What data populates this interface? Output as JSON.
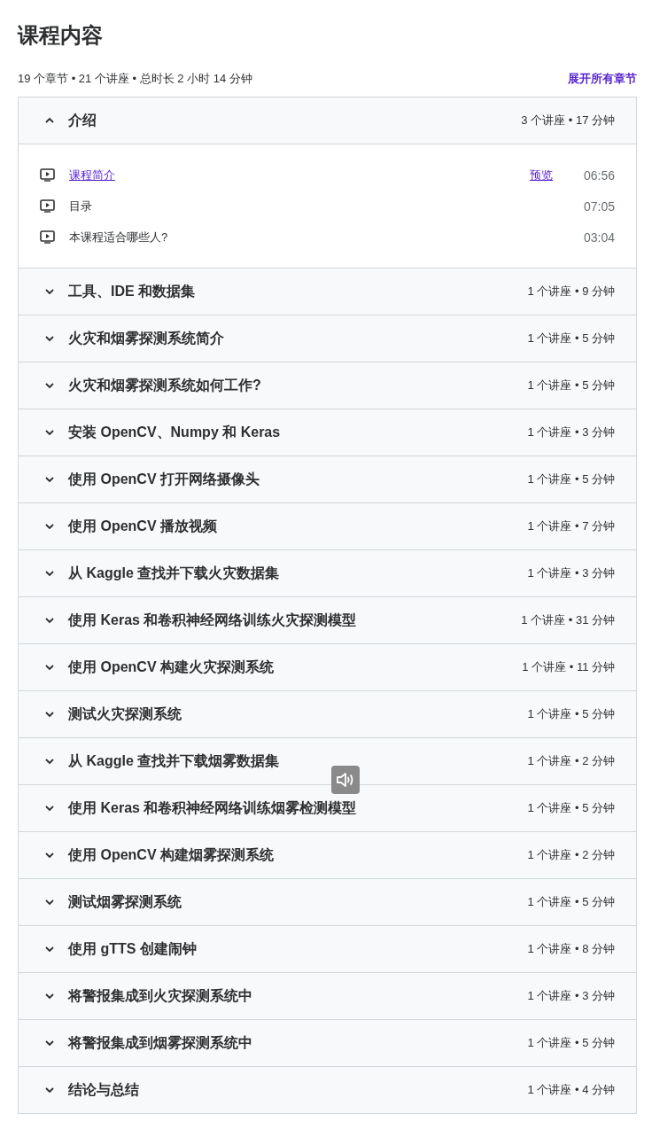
{
  "title": "课程内容",
  "summary": "19 个章节 • 21 个讲座 • 总时长 2 小时 14 分钟",
  "expand_all": "展开所有章节",
  "sections": [
    {
      "title": "介绍",
      "meta": "3 个讲座 • 17 分钟",
      "expanded": true,
      "lectures": [
        {
          "title": "课程简介",
          "link": true,
          "preview": "预览",
          "duration": "06:56"
        },
        {
          "title": "目录",
          "link": false,
          "duration": "07:05"
        },
        {
          "title": "本课程适合哪些人?",
          "link": false,
          "duration": "03:04"
        }
      ]
    },
    {
      "title": "工具、IDE 和数据集",
      "meta": "1 个讲座 • 9 分钟",
      "expanded": false
    },
    {
      "title": "火灾和烟雾探测系统简介",
      "meta": "1 个讲座 • 5 分钟",
      "expanded": false
    },
    {
      "title": "火灾和烟雾探测系统如何工作?",
      "meta": "1 个讲座 • 5 分钟",
      "expanded": false
    },
    {
      "title": "安装 OpenCV、Numpy 和 Keras",
      "meta": "1 个讲座 • 3 分钟",
      "expanded": false
    },
    {
      "title": "使用 OpenCV 打开网络摄像头",
      "meta": "1 个讲座 • 5 分钟",
      "expanded": false
    },
    {
      "title": "使用 OpenCV 播放视频",
      "meta": "1 个讲座 • 7 分钟",
      "expanded": false
    },
    {
      "title": "从 Kaggle 查找并下载火灾数据集",
      "meta": "1 个讲座 • 3 分钟",
      "expanded": false
    },
    {
      "title": "使用 Keras 和卷积神经网络训练火灾探测模型",
      "meta": "1 个讲座 • 31 分钟",
      "expanded": false
    },
    {
      "title": "使用 OpenCV 构建火灾探测系统",
      "meta": "1 个讲座 • 11 分钟",
      "expanded": false
    },
    {
      "title": "测试火灾探测系统",
      "meta": "1 个讲座 • 5 分钟",
      "expanded": false
    },
    {
      "title": "从 Kaggle 查找并下载烟雾数据集",
      "meta": "1 个讲座 • 2 分钟",
      "expanded": false
    },
    {
      "title": "使用 Keras 和卷积神经网络训练烟雾检测模型",
      "meta": "1 个讲座 • 5 分钟",
      "expanded": false
    },
    {
      "title": "使用 OpenCV 构建烟雾探测系统",
      "meta": "1 个讲座 • 2 分钟",
      "expanded": false
    },
    {
      "title": "测试烟雾探测系统",
      "meta": "1 个讲座 • 5 分钟",
      "expanded": false
    },
    {
      "title": "使用 gTTS 创建闹钟",
      "meta": "1 个讲座 • 8 分钟",
      "expanded": false
    },
    {
      "title": "将警报集成到火灾探测系统中",
      "meta": "1 个讲座 • 3 分钟",
      "expanded": false
    },
    {
      "title": "将警报集成到烟雾探测系统中",
      "meta": "1 个讲座 • 5 分钟",
      "expanded": false
    },
    {
      "title": "结论与总结",
      "meta": "1 个讲座 • 4 分钟",
      "expanded": false
    }
  ]
}
